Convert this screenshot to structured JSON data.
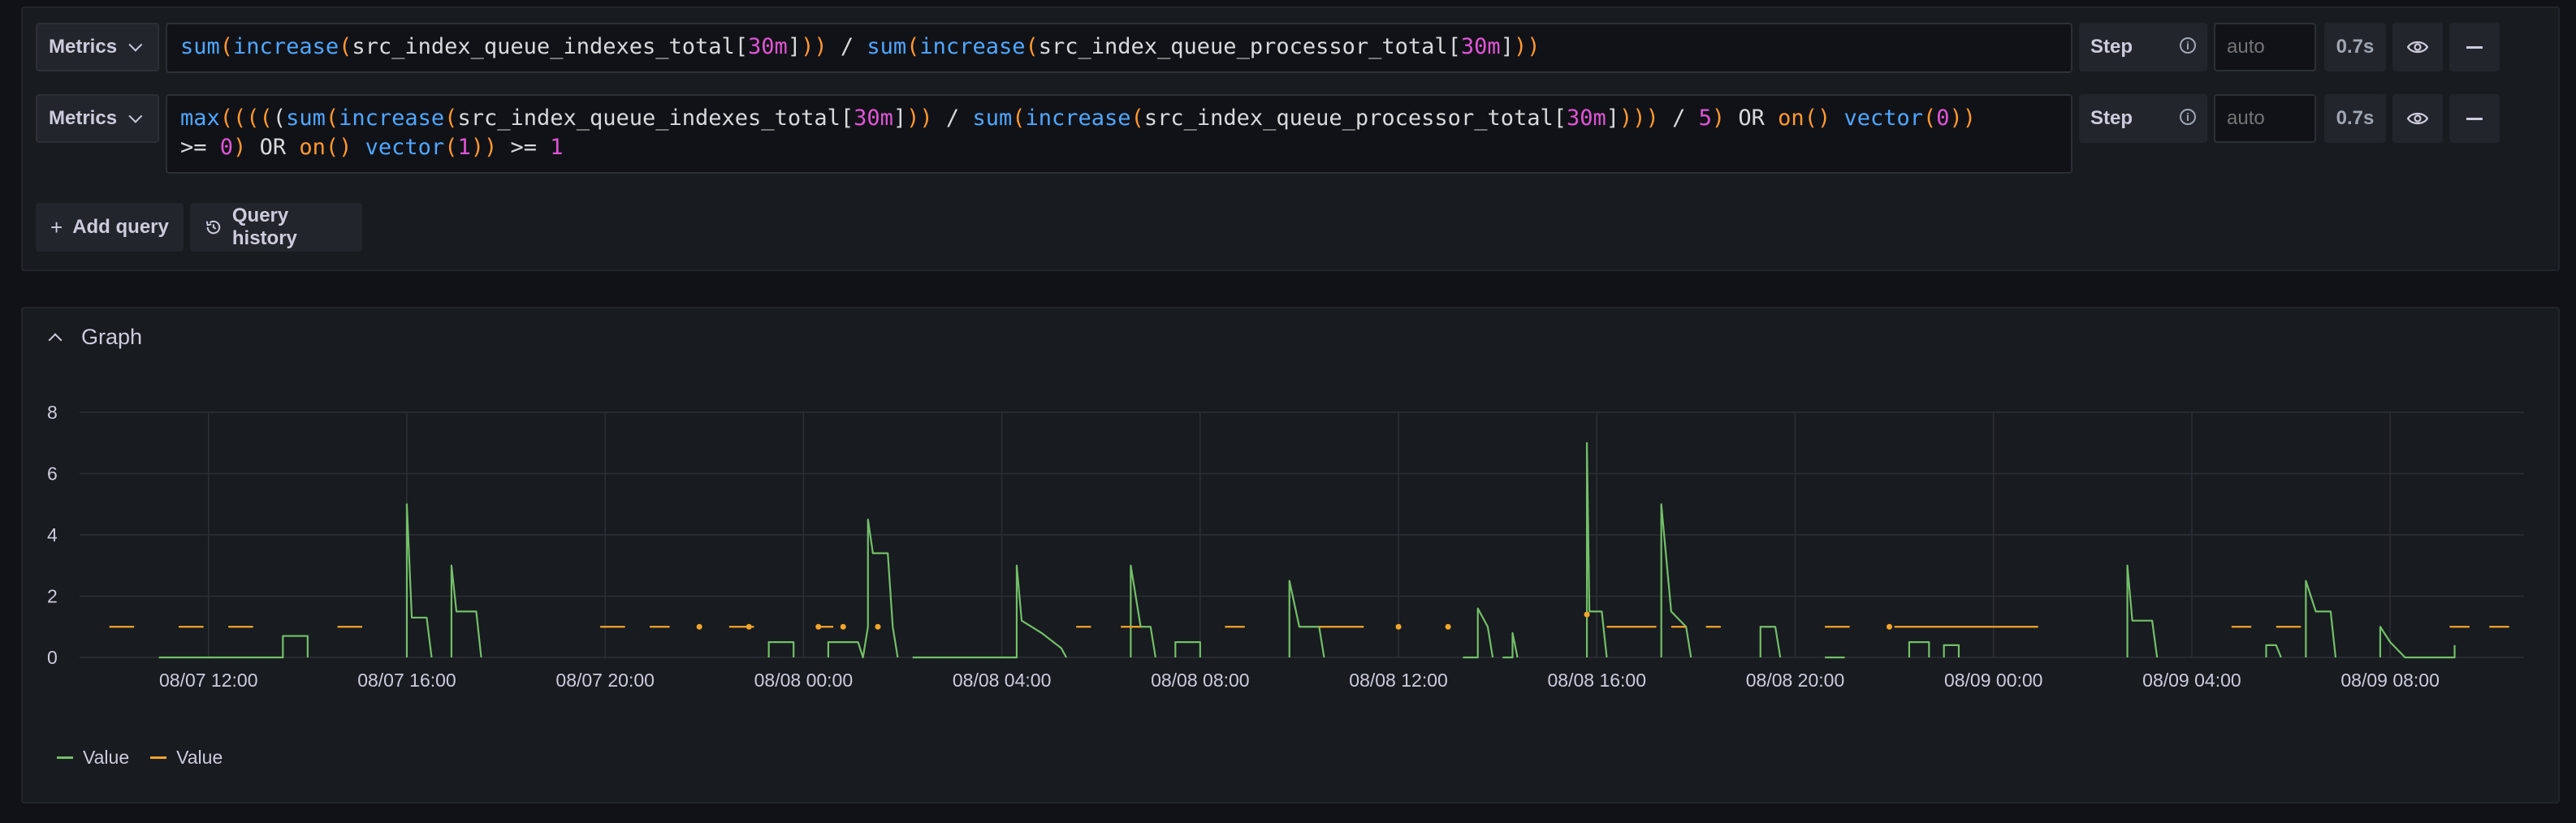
{
  "queries": [
    {
      "metrics_label": "Metrics",
      "tokens": [
        [
          "fn",
          "sum"
        ],
        [
          "br",
          "("
        ],
        [
          "fn",
          "increase"
        ],
        [
          "br",
          "("
        ],
        [
          "ident",
          "src_index_queue_indexes_total"
        ],
        [
          "ident",
          "["
        ],
        [
          "num",
          "30m"
        ],
        [
          "ident",
          "]"
        ],
        [
          "br",
          "))"
        ],
        [
          "ident",
          " / "
        ],
        [
          "fn",
          "sum"
        ],
        [
          "br",
          "("
        ],
        [
          "fn",
          "increase"
        ],
        [
          "br",
          "("
        ],
        [
          "ident",
          "src_index_queue_processor_total"
        ],
        [
          "ident",
          "["
        ],
        [
          "num",
          "30m"
        ],
        [
          "ident",
          "]"
        ],
        [
          "br",
          "))"
        ]
      ],
      "step_label": "Step",
      "step_placeholder": "auto",
      "time": "0.7s"
    },
    {
      "metrics_label": "Metrics",
      "tokens": [
        [
          "fn",
          "max"
        ],
        [
          "br",
          "(((("
        ],
        [
          "ident",
          "("
        ],
        [
          "fn",
          "sum"
        ],
        [
          "br",
          "("
        ],
        [
          "fn",
          "increase"
        ],
        [
          "br",
          "("
        ],
        [
          "ident",
          "src_index_queue_indexes_total"
        ],
        [
          "ident",
          "["
        ],
        [
          "num",
          "30m"
        ],
        [
          "ident",
          "]"
        ],
        [
          "br",
          "))"
        ],
        [
          "ident",
          " / "
        ],
        [
          "fn",
          "sum"
        ],
        [
          "br",
          "("
        ],
        [
          "fn",
          "increase"
        ],
        [
          "br",
          "("
        ],
        [
          "ident",
          "src_index_queue_processor_total"
        ],
        [
          "ident",
          "["
        ],
        [
          "num",
          "30m"
        ],
        [
          "ident",
          "]"
        ],
        [
          "br",
          ")))"
        ],
        [
          "ident",
          " / "
        ],
        [
          "num",
          "5"
        ],
        [
          "br",
          ")"
        ],
        [
          "ident",
          " OR "
        ],
        [
          "kw",
          "on"
        ],
        [
          "br",
          "()"
        ],
        [
          "ident",
          " "
        ],
        [
          "fn",
          "vector"
        ],
        [
          "br",
          "("
        ],
        [
          "num",
          "0"
        ],
        [
          "br",
          "))"
        ],
        [
          "ident",
          "\n"
        ],
        [
          "ident",
          ">= "
        ],
        [
          "num",
          "0"
        ],
        [
          "br",
          ")"
        ],
        [
          "ident",
          " OR "
        ],
        [
          "kw",
          "on"
        ],
        [
          "br",
          "()"
        ],
        [
          "ident",
          " "
        ],
        [
          "fn",
          "vector"
        ],
        [
          "br",
          "("
        ],
        [
          "num",
          "1"
        ],
        [
          "br",
          "))"
        ],
        [
          "ident",
          " >= "
        ],
        [
          "num",
          "1"
        ]
      ],
      "step_label": "Step",
      "step_placeholder": "auto",
      "time": "0.7s"
    }
  ],
  "actions": {
    "add_query": "Add query",
    "query_history": "Query history"
  },
  "graph": {
    "title": "Graph"
  },
  "colors": {
    "green": "#73bf69",
    "orange": "#f2a52c",
    "grid": "#2c3036"
  },
  "chart_data": {
    "type": "line",
    "x_ticks": [
      "08/07 12:00",
      "08/07 16:00",
      "08/07 20:00",
      "08/08 00:00",
      "08/08 04:00",
      "08/08 08:00",
      "08/08 12:00",
      "08/08 16:00",
      "08/08 20:00",
      "08/09 00:00",
      "08/09 04:00",
      "08/09 08:00"
    ],
    "x_tick_hours": [
      0,
      4,
      8,
      12,
      16,
      20,
      24,
      28,
      32,
      36,
      40,
      44
    ],
    "xlim": [
      -2.6,
      46.7
    ],
    "y_ticks": [
      0,
      2,
      4,
      6,
      8
    ],
    "ylim": [
      0,
      8
    ],
    "series": [
      {
        "name": "Value",
        "color": "#73bf69",
        "segments": [
          [
            [
              -1.0,
              0
            ],
            [
              1.5,
              0
            ],
            [
              1.5,
              0.7
            ],
            [
              2.0,
              0.7
            ],
            [
              2.0,
              0
            ]
          ],
          [
            [
              4.0,
              0
            ],
            [
              4.0,
              5.0
            ],
            [
              4.1,
              1.3
            ],
            [
              4.4,
              1.3
            ],
            [
              4.5,
              0
            ]
          ],
          [
            [
              4.9,
              0
            ],
            [
              4.9,
              3.0
            ],
            [
              5.0,
              1.5
            ],
            [
              5.4,
              1.5
            ],
            [
              5.5,
              0
            ]
          ],
          [
            [
              11.3,
              0
            ],
            [
              11.3,
              0.5
            ],
            [
              11.8,
              0.5
            ],
            [
              11.8,
              0
            ]
          ],
          [
            [
              12.5,
              0
            ],
            [
              12.5,
              0.5
            ],
            [
              13.1,
              0.5
            ],
            [
              13.2,
              0
            ],
            [
              13.3,
              1.0
            ],
            [
              13.3,
              4.5
            ],
            [
              13.4,
              3.4
            ],
            [
              13.7,
              3.4
            ],
            [
              13.8,
              1.0
            ],
            [
              13.9,
              0
            ]
          ],
          [
            [
              14.2,
              0
            ],
            [
              16.3,
              0
            ],
            [
              16.3,
              3.0
            ],
            [
              16.4,
              1.2
            ],
            [
              16.8,
              0.8
            ],
            [
              17.2,
              0.3
            ],
            [
              17.3,
              0
            ]
          ],
          [
            [
              18.6,
              0
            ],
            [
              18.6,
              3.0
            ],
            [
              18.8,
              1.0
            ],
            [
              19.0,
              1.0
            ],
            [
              19.1,
              0
            ]
          ],
          [
            [
              19.5,
              0
            ],
            [
              19.5,
              0.5
            ],
            [
              20.0,
              0.5
            ],
            [
              20.0,
              0
            ]
          ],
          [
            [
              21.8,
              0
            ],
            [
              21.8,
              2.5
            ],
            [
              22.0,
              1.0
            ],
            [
              22.4,
              1.0
            ],
            [
              22.5,
              0
            ]
          ],
          [
            [
              25.3,
              0
            ],
            [
              25.6,
              0
            ],
            [
              25.6,
              1.6
            ],
            [
              25.8,
              1.0
            ],
            [
              25.9,
              0
            ]
          ],
          [
            [
              26.1,
              0
            ],
            [
              26.3,
              0
            ],
            [
              26.3,
              0.8
            ],
            [
              26.4,
              0
            ]
          ],
          [
            [
              27.8,
              0
            ],
            [
              27.8,
              7.0
            ],
            [
              27.85,
              1.5
            ],
            [
              28.1,
              1.5
            ],
            [
              28.2,
              0
            ]
          ],
          [
            [
              29.3,
              0
            ],
            [
              29.3,
              5.0
            ],
            [
              29.5,
              1.5
            ],
            [
              29.8,
              1.0
            ],
            [
              29.9,
              0
            ]
          ],
          [
            [
              31.3,
              0
            ],
            [
              31.3,
              1.0
            ],
            [
              31.6,
              1.0
            ],
            [
              31.7,
              0
            ]
          ],
          [
            [
              32.6,
              0
            ],
            [
              33.0,
              0
            ]
          ],
          [
            [
              34.3,
              0
            ],
            [
              34.3,
              0.5
            ],
            [
              34.7,
              0.5
            ],
            [
              34.7,
              0
            ]
          ],
          [
            [
              35.0,
              0
            ],
            [
              35.0,
              0.4
            ],
            [
              35.3,
              0.4
            ],
            [
              35.3,
              0
            ]
          ],
          [
            [
              38.7,
              0
            ],
            [
              38.7,
              3.0
            ],
            [
              38.8,
              1.2
            ],
            [
              39.2,
              1.2
            ],
            [
              39.3,
              0
            ]
          ],
          [
            [
              41.5,
              0
            ],
            [
              41.5,
              0.4
            ],
            [
              41.7,
              0.4
            ],
            [
              41.8,
              0
            ]
          ],
          [
            [
              42.3,
              0
            ],
            [
              42.3,
              2.5
            ],
            [
              42.5,
              1.5
            ],
            [
              42.8,
              1.5
            ],
            [
              42.9,
              0
            ]
          ],
          [
            [
              43.8,
              0
            ],
            [
              43.8,
              1.0
            ],
            [
              44.0,
              0.5
            ],
            [
              44.3,
              0
            ],
            [
              45.3,
              0
            ],
            [
              45.3,
              0.4
            ]
          ]
        ]
      },
      {
        "name": "Value",
        "color": "#f2a52c",
        "segments": [
          [
            [
              -2.0,
              1
            ],
            [
              -1.5,
              1
            ]
          ],
          [
            [
              -0.6,
              1
            ],
            [
              -0.1,
              1
            ]
          ],
          [
            [
              0.4,
              1
            ],
            [
              0.9,
              1
            ]
          ],
          [
            [
              2.6,
              1
            ],
            [
              3.1,
              1
            ]
          ],
          [
            [
              7.9,
              1
            ],
            [
              8.4,
              1
            ]
          ],
          [
            [
              8.9,
              1
            ],
            [
              9.3,
              1
            ]
          ],
          [
            [
              10.5,
              1
            ],
            [
              11.0,
              1
            ]
          ],
          [
            [
              12.3,
              1
            ],
            [
              12.6,
              1
            ]
          ],
          [
            [
              17.5,
              1
            ],
            [
              17.8,
              1
            ]
          ],
          [
            [
              18.4,
              1
            ],
            [
              18.8,
              1
            ]
          ],
          [
            [
              20.5,
              1
            ],
            [
              20.9,
              1
            ]
          ],
          [
            [
              22.4,
              1
            ],
            [
              23.3,
              1
            ]
          ],
          [
            [
              28.2,
              1
            ],
            [
              29.2,
              1
            ]
          ],
          [
            [
              29.5,
              1
            ],
            [
              29.8,
              1
            ]
          ],
          [
            [
              30.2,
              1
            ],
            [
              30.5,
              1
            ]
          ],
          [
            [
              32.6,
              1
            ],
            [
              33.1,
              1
            ]
          ],
          [
            [
              34.0,
              1
            ],
            [
              36.9,
              1
            ]
          ],
          [
            [
              40.8,
              1
            ],
            [
              41.2,
              1
            ]
          ],
          [
            [
              41.7,
              1
            ],
            [
              42.2,
              1
            ]
          ],
          [
            [
              45.2,
              1
            ],
            [
              45.6,
              1
            ]
          ],
          [
            [
              46.0,
              1
            ],
            [
              46.4,
              1
            ]
          ]
        ],
        "points": [
          [
            9.9,
            1
          ],
          [
            10.9,
            1
          ],
          [
            12.3,
            1
          ],
          [
            12.8,
            1
          ],
          [
            13.5,
            1
          ],
          [
            24.0,
            1
          ],
          [
            25.0,
            1
          ],
          [
            27.8,
            1.4
          ],
          [
            33.9,
            1
          ]
        ]
      }
    ]
  }
}
